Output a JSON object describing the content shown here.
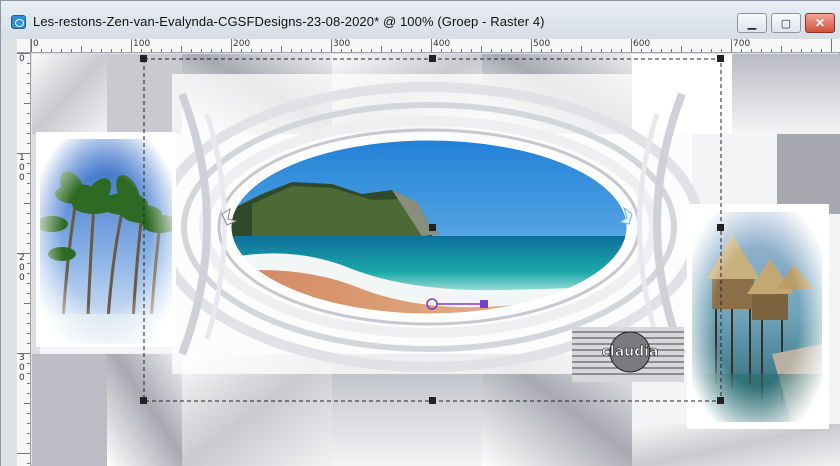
{
  "window": {
    "title": "Les-restons-Zen-van-Evalynda-CGSFDesigns-23-08-2020* @ 100% (Groep - Raster 4)",
    "buttons": [
      "minimize",
      "maximize",
      "close"
    ],
    "icons": {
      "app": "app-document-icon",
      "minimize": "minimize-icon",
      "maximize": "maximize-icon",
      "close": "close-icon"
    }
  },
  "rulers": {
    "horizontal_labels": [
      "0",
      "100",
      "200",
      "300",
      "400",
      "500",
      "600",
      "700"
    ],
    "vertical_labels": [
      "0",
      "100",
      "200",
      "300"
    ]
  },
  "canvas": {
    "watermark": "claudia",
    "zoom": "100%",
    "layer": "Groep - Raster 4"
  },
  "colors": {
    "titlebar": "#dfe3e8",
    "close_button": "#d2503a",
    "selection_line": "#222222",
    "transform_handle": "#7a3dd0",
    "sky": "#2a8fdc",
    "sea": "#1a9fa8",
    "sand": "#d9a078"
  }
}
